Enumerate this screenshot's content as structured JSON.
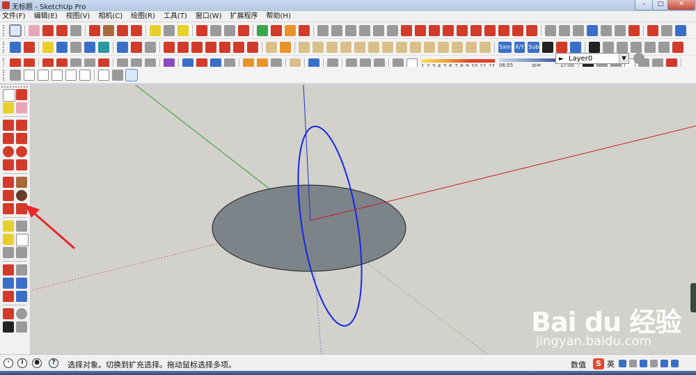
{
  "window": {
    "title": "无标题 - SketchUp Pro"
  },
  "menus": [
    "文件(F)",
    "编辑(E)",
    "视图(V)",
    "相机(C)",
    "绘图(R)",
    "工具(T)",
    "窗口(W)",
    "扩展程序",
    "帮助(H)"
  ],
  "layer": {
    "current": "Layer0"
  },
  "shadow": {
    "time_scale": [
      "1",
      "2",
      "3",
      "4",
      "5",
      "6",
      "7",
      "8",
      "9",
      "10",
      "11",
      "12"
    ],
    "time_start": "06:55",
    "time_mid": "中午",
    "time_end": "17:00"
  },
  "extension_labels": [
    "Sxin",
    "X/Y",
    "Sub"
  ],
  "status": {
    "hint": "选择对象。切换到扩充选择。拖动鼠标选择多项。",
    "measurement_label": "数值",
    "ime_mode": "英"
  },
  "watermark": {
    "brand": "Bai du 经验",
    "url": "jingyan.baidu.com"
  },
  "colors": {
    "axis_red": "#c8191e",
    "axis_green": "#2f9a2f",
    "axis_blue": "#1c2fc8",
    "circle_blue": "#1426e6",
    "disk_fill": "#7c8489",
    "annotation_red": "#e8262a",
    "viewport_bg": "#d2d1cb"
  },
  "icons": {
    "select": "select-arrow-icon",
    "eraser": "eraser-icon",
    "pencil": "pencil-icon",
    "rotate": "rotate-icon",
    "follow_me": "follow-me-icon"
  }
}
